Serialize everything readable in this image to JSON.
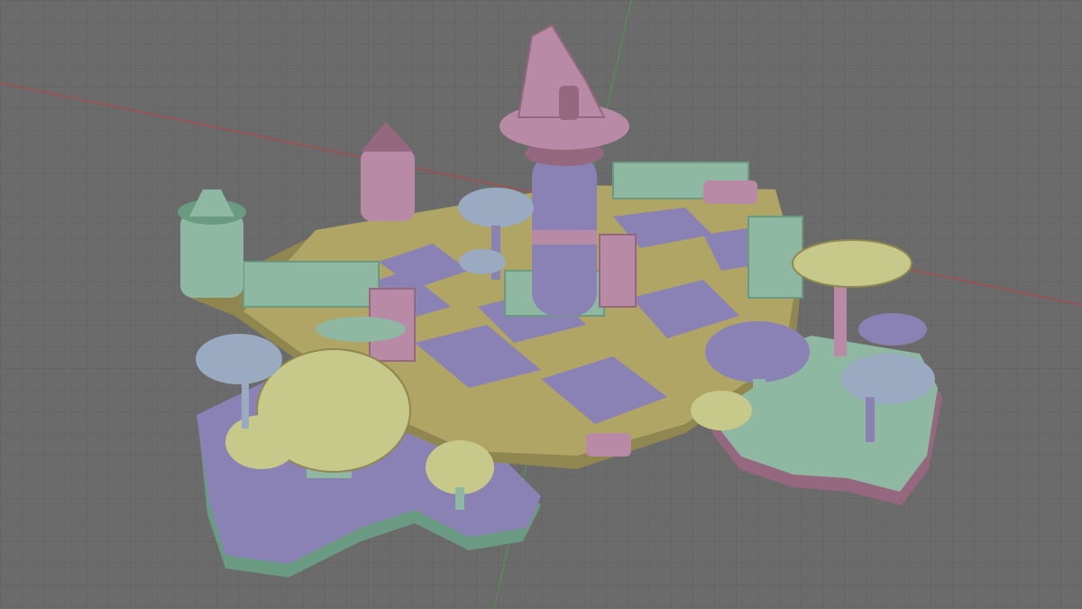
{
  "viewport": {
    "mode": "3d-viewport",
    "shading": "solid",
    "colors": {
      "background": "#6b6b6b",
      "grid_line": "#5e5e5e",
      "axis_x": "#b04848",
      "axis_y": "#4e9a4e",
      "olive": "#b0a564",
      "olive_dark": "#8f8650",
      "lavender": "#8a82b4",
      "lavender_dark": "#6c6496",
      "pink": "#b88aa6",
      "pink_dark": "#95687f",
      "mint": "#8fb8a2",
      "mint_dark": "#6b9a82",
      "blue_grey": "#9aaac0",
      "yellow_green": "#c7c98a"
    }
  },
  "scene": {
    "objects": [
      {
        "name": "checker-floor",
        "kind": "tiled-floor"
      },
      {
        "name": "witch-hat-tower",
        "kind": "tower"
      },
      {
        "name": "teacup-tower-left",
        "kind": "tower"
      },
      {
        "name": "pink-tower-back",
        "kind": "tower"
      },
      {
        "name": "card-fence",
        "kind": "fence"
      },
      {
        "name": "mushroom-cluster-left",
        "kind": "mushroom"
      },
      {
        "name": "mushroom-cluster-right",
        "kind": "mushroom"
      },
      {
        "name": "floating-island-left",
        "kind": "island"
      },
      {
        "name": "floating-island-right",
        "kind": "island"
      }
    ]
  }
}
